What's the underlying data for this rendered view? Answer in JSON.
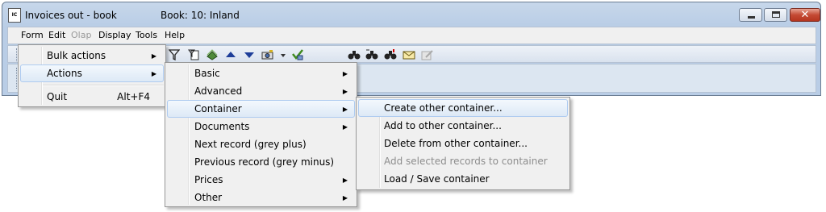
{
  "window": {
    "title": "Invoices out - book",
    "book": "Book: 10: Inland",
    "app_icon_text": "IC",
    "buttons": {
      "minimize": "",
      "maximize": "",
      "close": "✕"
    }
  },
  "menubar": {
    "items": [
      {
        "label": "Form"
      },
      {
        "label": "Edit"
      },
      {
        "label": "Olap",
        "disabled": true
      },
      {
        "label": "Display"
      },
      {
        "label": "Tools"
      },
      {
        "label": "Help"
      }
    ]
  },
  "toolbar": {
    "icons": [
      "filter-icon",
      "filter-document-icon",
      "money-stack-icon",
      "arrow-up-icon",
      "arrow-down-icon",
      "camera-icon",
      "dropdown-arrow-icon",
      "check-export-icon",
      "binoculars-icon",
      "binoculars-next-icon",
      "binoculars-mark-icon",
      "envelope-icon",
      "disabled-edit-icon"
    ]
  },
  "form_menu": {
    "items": [
      {
        "label": "Bulk actions",
        "submenu": true
      },
      {
        "label": "Actions",
        "submenu": true,
        "highlighted": true
      },
      {
        "label": "Quit",
        "shortcut": "Alt+F4"
      }
    ]
  },
  "actions_menu": {
    "items": [
      {
        "label": "Basic",
        "submenu": true
      },
      {
        "label": "Advanced",
        "submenu": true
      },
      {
        "label": "Container",
        "submenu": true,
        "highlighted": true
      },
      {
        "label": "Documents",
        "submenu": true
      },
      {
        "label": "Next record (grey plus)"
      },
      {
        "label": "Previous record (grey minus)"
      },
      {
        "label": "Prices",
        "submenu": true
      },
      {
        "label": "Other",
        "submenu": true
      }
    ]
  },
  "container_menu": {
    "items": [
      {
        "label": "Create other container...",
        "highlighted": true
      },
      {
        "label": "Add to other container..."
      },
      {
        "label": "Delete from other container..."
      },
      {
        "label": "Add selected records to container",
        "disabled": true
      },
      {
        "label": "Load / Save container"
      }
    ]
  },
  "arrow_glyph": "▶",
  "colors": {
    "highlight_border": "#aecbf0",
    "titlebar": "#b9cde6",
    "close_button": "#c44a34"
  }
}
